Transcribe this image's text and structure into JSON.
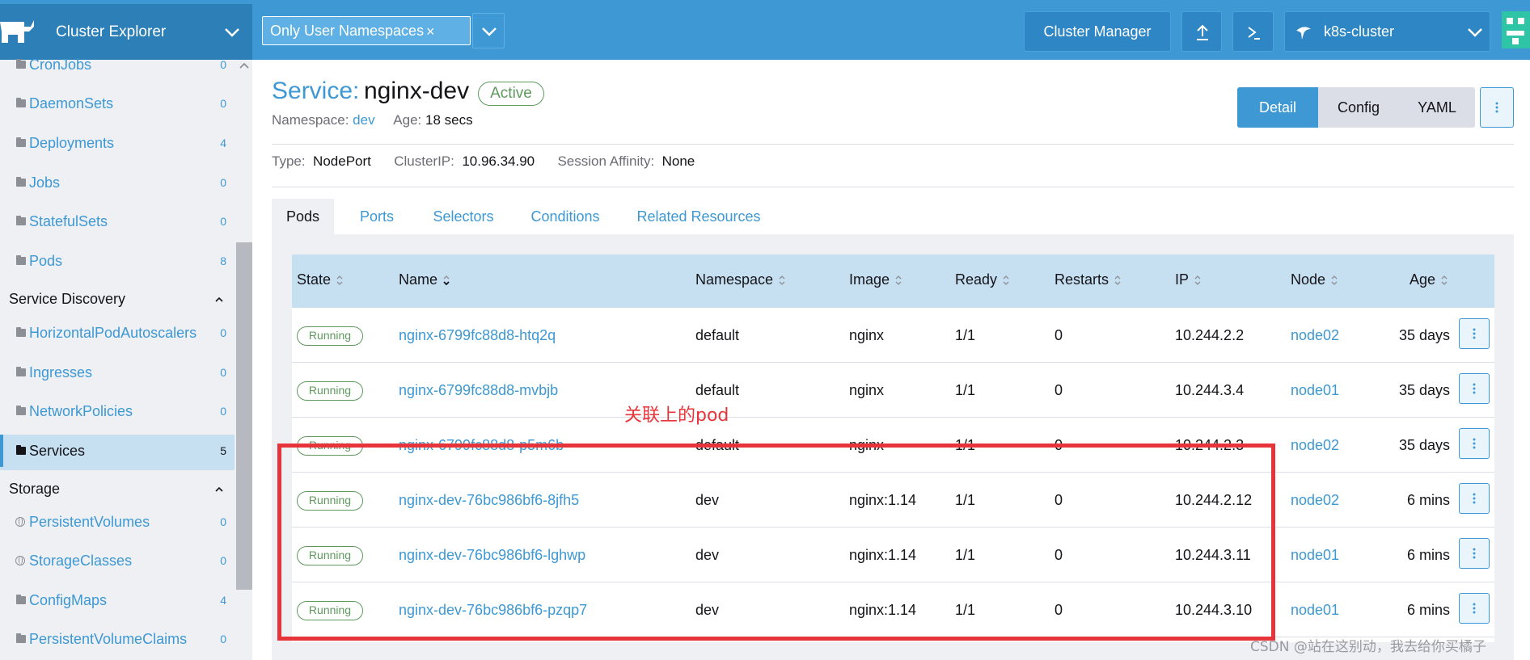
{
  "header": {
    "app_title": "Cluster Explorer",
    "namespace_filter": "Only User Namespaces",
    "namespace_filter_close": "×",
    "cluster_manager": "Cluster Manager",
    "cluster_name": "k8s-cluster",
    "accent_color": "#3d98d3"
  },
  "sidebar": {
    "items_top": [
      {
        "label": "CronJobs",
        "count": "0"
      },
      {
        "label": "DaemonSets",
        "count": "0"
      },
      {
        "label": "Deployments",
        "count": "4"
      },
      {
        "label": "Jobs",
        "count": "0"
      },
      {
        "label": "StatefulSets",
        "count": "0"
      },
      {
        "label": "Pods",
        "count": "8"
      }
    ],
    "group_service_discovery": "Service Discovery",
    "items_sd": [
      {
        "label": "HorizontalPodAutoscalers",
        "count": "0"
      },
      {
        "label": "Ingresses",
        "count": "0"
      },
      {
        "label": "NetworkPolicies",
        "count": "0"
      },
      {
        "label": "Services",
        "count": "5"
      }
    ],
    "group_storage": "Storage",
    "items_storage": [
      {
        "label": "PersistentVolumes",
        "count": "0"
      },
      {
        "label": "StorageClasses",
        "count": "0"
      },
      {
        "label": "ConfigMaps",
        "count": "4"
      },
      {
        "label": "PersistentVolumeClaims",
        "count": "0"
      }
    ]
  },
  "resource": {
    "kind_label": "Service:",
    "name": "nginx-dev",
    "status": "Active",
    "namespace_label": "Namespace:",
    "namespace": "dev",
    "age_label": "Age:",
    "age": "18 secs",
    "type_label": "Type:",
    "type": "NodePort",
    "cluster_ip_label": "ClusterIP:",
    "cluster_ip": "10.96.34.90",
    "affinity_label": "Session Affinity:",
    "affinity": "None"
  },
  "view_switch": {
    "detail": "Detail",
    "config": "Config",
    "yaml": "YAML"
  },
  "tabs": [
    "Pods",
    "Ports",
    "Selectors",
    "Conditions",
    "Related Resources"
  ],
  "table": {
    "columns": [
      "State",
      "Name",
      "Namespace",
      "Image",
      "Ready",
      "Restarts",
      "IP",
      "Node",
      "Age"
    ],
    "rows": [
      {
        "state": "Running",
        "name": "nginx-6799fc88d8-htq2q",
        "namespace": "default",
        "image": "nginx",
        "ready": "1/1",
        "restarts": "0",
        "ip": "10.244.2.2",
        "node": "node02",
        "age": "35 days"
      },
      {
        "state": "Running",
        "name": "nginx-6799fc88d8-mvbjb",
        "namespace": "default",
        "image": "nginx",
        "ready": "1/1",
        "restarts": "0",
        "ip": "10.244.3.4",
        "node": "node01",
        "age": "35 days"
      },
      {
        "state": "Running",
        "name": "nginx-6799fc88d8-p5m6b",
        "namespace": "default",
        "image": "nginx",
        "ready": "1/1",
        "restarts": "0",
        "ip": "10.244.2.3",
        "node": "node02",
        "age": "35 days"
      },
      {
        "state": "Running",
        "name": "nginx-dev-76bc986bf6-8jfh5",
        "namespace": "dev",
        "image": "nginx:1.14",
        "ready": "1/1",
        "restarts": "0",
        "ip": "10.244.2.12",
        "node": "node02",
        "age": "6 mins"
      },
      {
        "state": "Running",
        "name": "nginx-dev-76bc986bf6-lghwp",
        "namespace": "dev",
        "image": "nginx:1.14",
        "ready": "1/1",
        "restarts": "0",
        "ip": "10.244.3.11",
        "node": "node01",
        "age": "6 mins"
      },
      {
        "state": "Running",
        "name": "nginx-dev-76bc986bf6-pzqp7",
        "namespace": "dev",
        "image": "nginx:1.14",
        "ready": "1/1",
        "restarts": "0",
        "ip": "10.244.3.10",
        "node": "node01",
        "age": "6 mins"
      }
    ]
  },
  "annotation": {
    "text": "关联上的pod",
    "color": "#e7343a"
  },
  "watermark": "CSDN @站在这别动，我去给你买橘子"
}
